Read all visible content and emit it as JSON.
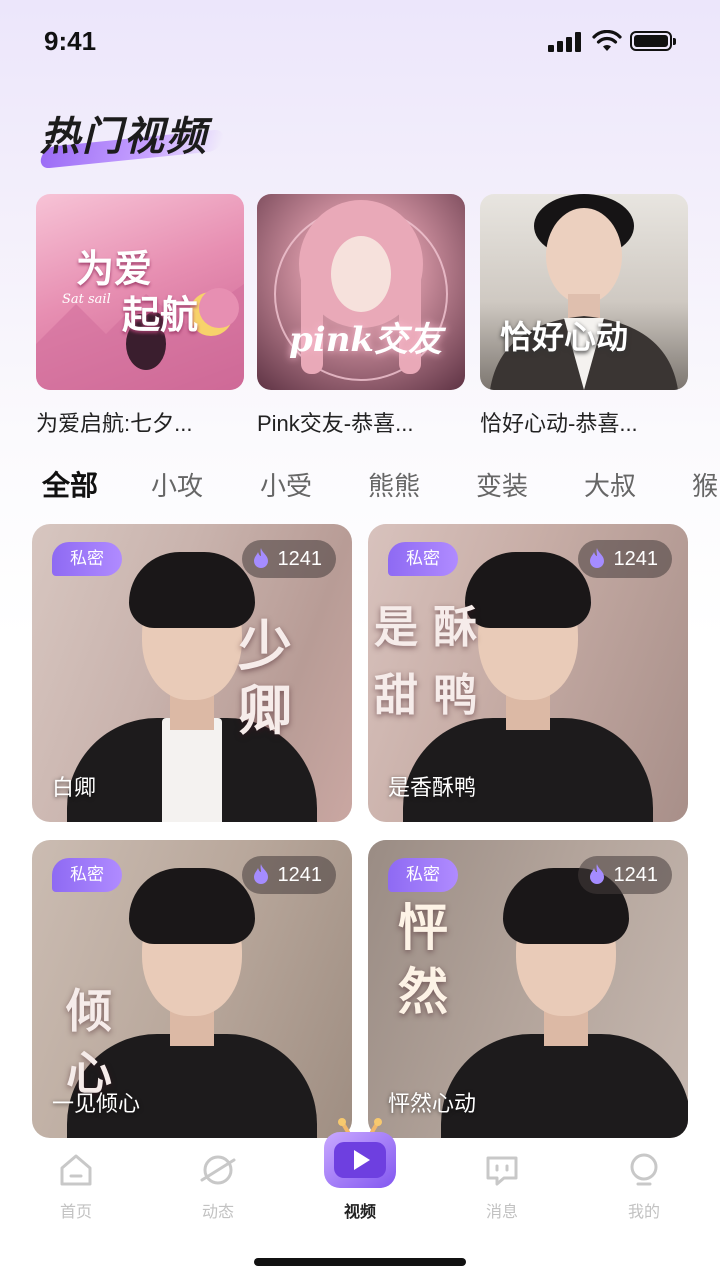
{
  "status_bar": {
    "time": "9:41"
  },
  "page_title": "热门视频",
  "hot_videos": [
    {
      "caption": "为爱启航:七夕...",
      "art_line1": "为爱",
      "art_line2": "起航",
      "art_small": "Sat sail"
    },
    {
      "caption": "Pink交友-恭喜...",
      "art_line1": "pink交友"
    },
    {
      "caption": "恰好心动-恭喜...",
      "art_line1": "恰好心动"
    }
  ],
  "tabs": [
    {
      "label": "全部",
      "active": true
    },
    {
      "label": "小攻"
    },
    {
      "label": "小受"
    },
    {
      "label": "熊熊"
    },
    {
      "label": "变装"
    },
    {
      "label": "大叔"
    },
    {
      "label": "猴"
    }
  ],
  "videos": [
    {
      "badge": "私密",
      "count": "1241",
      "name": "白卿",
      "art": "少\n卿"
    },
    {
      "badge": "私密",
      "count": "1241",
      "name": "是香酥鸭",
      "art": "是 酥\n甜 鸭"
    },
    {
      "badge": "私密",
      "count": "1241",
      "name": "一见倾心",
      "art": "倾\n心"
    },
    {
      "badge": "私密",
      "count": "1241",
      "name": "怦然心动",
      "art": "怦\n然"
    }
  ],
  "bottom_nav": [
    {
      "label": "首页",
      "icon": "home-icon"
    },
    {
      "label": "动态",
      "icon": "planet-icon"
    },
    {
      "label": "视频",
      "icon": "tv-icon",
      "active": true
    },
    {
      "label": "消息",
      "icon": "message-icon"
    },
    {
      "label": "我的",
      "icon": "profile-icon"
    }
  ],
  "colors": {
    "accent": "#9b6cf6",
    "badge": "#8e6af3",
    "active_text": "#222222",
    "inactive_text": "#c2c2c2"
  }
}
